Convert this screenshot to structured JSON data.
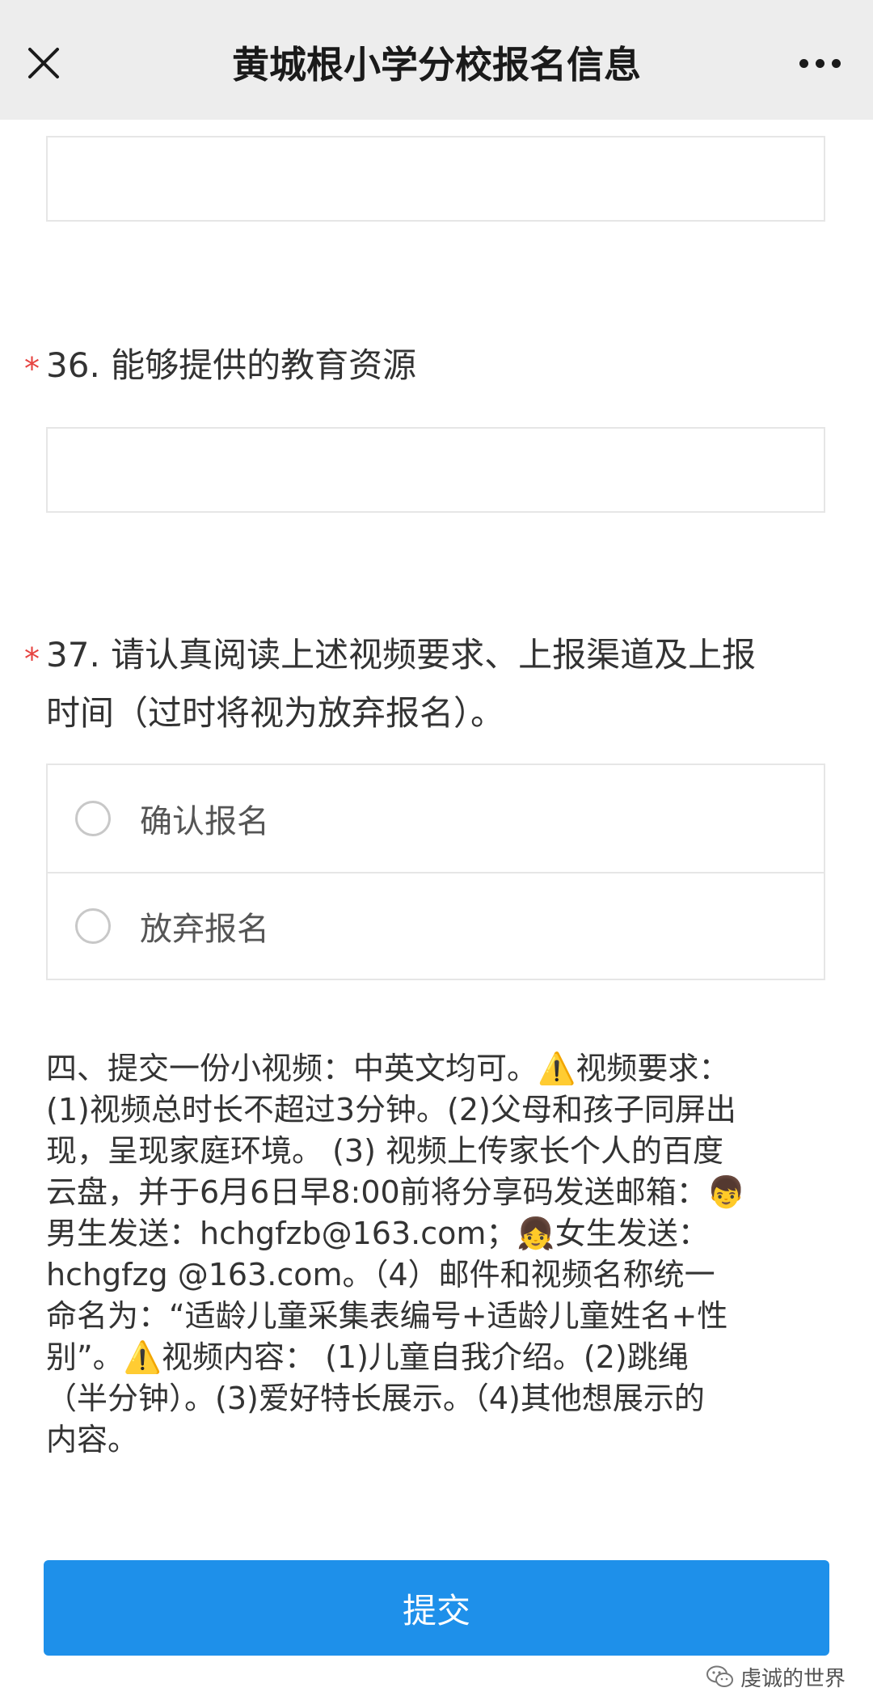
{
  "nav": {
    "title": "黄城根小学分校报名信息",
    "close_icon": "close-icon",
    "more_icon": "more-dots-icon"
  },
  "questions": {
    "q36": {
      "required_mark": "*",
      "text": "36. 能够提供的教育资源",
      "answer": ""
    },
    "q37": {
      "required_mark": "*",
      "text_line1": "37. 请认真阅读上述视频要求、上报渠道及上报",
      "text_line2": "时间（过时将视为放弃报名）。",
      "options": [
        "确认报名",
        "放弃报名"
      ]
    },
    "prev_answer": ""
  },
  "description": {
    "l1a": "四、提交一份小视频：中英文均可。",
    "warn1": "⚠️",
    "l1b": "视频要求：",
    "l2": "(1)视频总时长不超过3分钟。(2)父母和孩子同屏出",
    "l3": "现，呈现家庭环境。 (3) 视频上传家长个人的百度",
    "l4a": "云盘，并于6月6日早8:00前将分享码发送邮箱：",
    "boy_emoji": "👦",
    "l5a": "男生发送：hchgfzb@163.com；",
    "girl_emoji": "👧",
    "l5b": "女生发送：",
    "l6": "hchgfzg @163.com。（4）邮件和视频名称统一",
    "l7": "命名为：“适龄儿童采集表编号+适龄儿童姓名+性",
    "l8a": "别”。",
    "warn2": "⚠️",
    "l8b": "视频内容： (1)儿童自我介绍。(2)跳绳",
    "l9": "（半分钟）。(3)爱好特长展示。（4)其他想展示的",
    "l10": "内容。"
  },
  "submit_label": "提交",
  "watermark": {
    "text": "虔诚的世界",
    "icon": "wechat-icon"
  },
  "colors": {
    "nav_bg": "#ededed",
    "required": "#e64340",
    "submit_bg": "#1e90ea",
    "border": "#e6e6e6"
  }
}
